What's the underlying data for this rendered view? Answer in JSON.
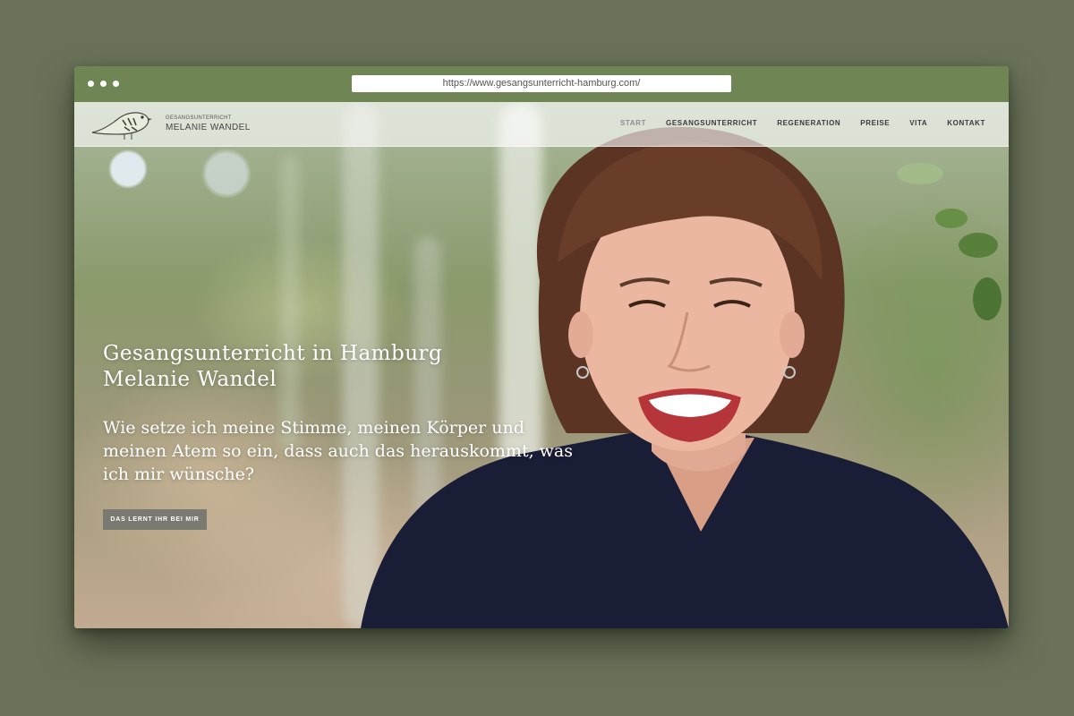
{
  "browser": {
    "url": "https://www.gesangsunterricht-hamburg.com/"
  },
  "site": {
    "logo_top": "GESANGSUNTERRICHT",
    "logo_name": "MELANIE WANDEL",
    "logo_icon": "bird-icon",
    "nav": [
      {
        "label": "START",
        "active": true
      },
      {
        "label": "GESANGSUNTERRICHT",
        "active": false
      },
      {
        "label": "REGENERATION",
        "active": false
      },
      {
        "label": "PREISE",
        "active": false
      },
      {
        "label": "VITA",
        "active": false
      },
      {
        "label": "KONTAKT",
        "active": false
      }
    ]
  },
  "hero": {
    "title_line1": "Gesangsunterricht in Hamburg",
    "title_line2": "Melanie Wandel",
    "subtitle": "Wie setze ich meine Stimme, meinen Körper und meinen Atem so ein, dass auch das herauskommt, was ich mir wünsche?",
    "cta_label": "DAS LERNT IHR BEI MIR"
  },
  "colors": {
    "page_background": "#6a735a",
    "titlebar": "#6f8654",
    "cta_background": "#7a7a72"
  }
}
